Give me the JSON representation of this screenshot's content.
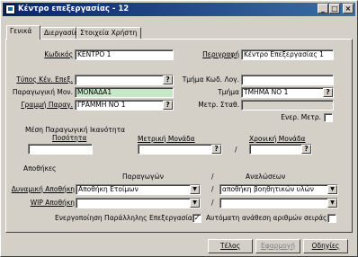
{
  "window": {
    "title": "Κέντρο  επεξεργασίας - 12"
  },
  "titlebar_buttons": [
    "_",
    "□",
    "×"
  ],
  "tabs": [
    "Γενικά",
    "Διεργασίες",
    "Στοιχεία Χρήστη"
  ],
  "general": {
    "code_label": "Κωδικός",
    "code_value": "ΚΕΝΤΡΟ 1",
    "description_label": "Περιγραφή",
    "description_value": "Κέντρο Επεξεργασίας 1",
    "center_type_label": "Τύπος Κέν. Επεξ.",
    "center_type_value": "",
    "dept_code_label": "Τμήμα Κωδ. Λογ.",
    "dept_code_value": "",
    "prod_unit_label": "Παραγωγική Μον.",
    "prod_unit_value": "ΜΟΝΑΔΑ1",
    "dept_label": "Τμήμα",
    "dept_value": "ΤΜΗΜΑ ΝΟ 1",
    "prod_line_label": "Γραμμή Παραγ.",
    "prod_line_value": "ΓΡΑΜΜΗ ΝΟ 1",
    "measure_station_label": "Μετρ. Σταθ.",
    "measure_station_value": "",
    "enabled_measure_label": "Ενερ. Μετρ.",
    "enabled_measure_checked": false,
    "lookup_button": "?"
  },
  "capacity": {
    "section_label": "Μέση Παραγωγική Ικανότητα",
    "quantity_label": "Ποσότητα",
    "quantity_value": "",
    "measure_unit_label": "Μετρική Μονάδα",
    "measure_unit_value": "",
    "time_unit_label": "Χρονική Μονάδα",
    "time_unit_value": "",
    "separator": "/"
  },
  "warehouses": {
    "section_label": "Αποθήκες",
    "col_products_label": "Παραγωγών",
    "col_consumption_label": "Αναλώσεων",
    "separator": "/",
    "default_wh_label": "Δυναμική Αποθήκη",
    "default_wh_products": "Αποθήκη Ετοίμων",
    "default_wh_consumption": "αποθήκη βοηθητικών υλών",
    "wip_wh_label": "WIP Αποθήκη",
    "wip_wh_products": "",
    "wip_wh_consumption": ""
  },
  "options": {
    "activate_label": "Ενεργοποίηση Παράλληλης Επεξεργασίας",
    "activate_checked": true,
    "auto_serial_label": "Αυτόματη ανάθεση αριθμών σειράς",
    "auto_serial_checked": false
  },
  "buttons": {
    "ok": "Τέλος",
    "apply": "Εφαρμογή",
    "help": "Οδηγίες"
  }
}
